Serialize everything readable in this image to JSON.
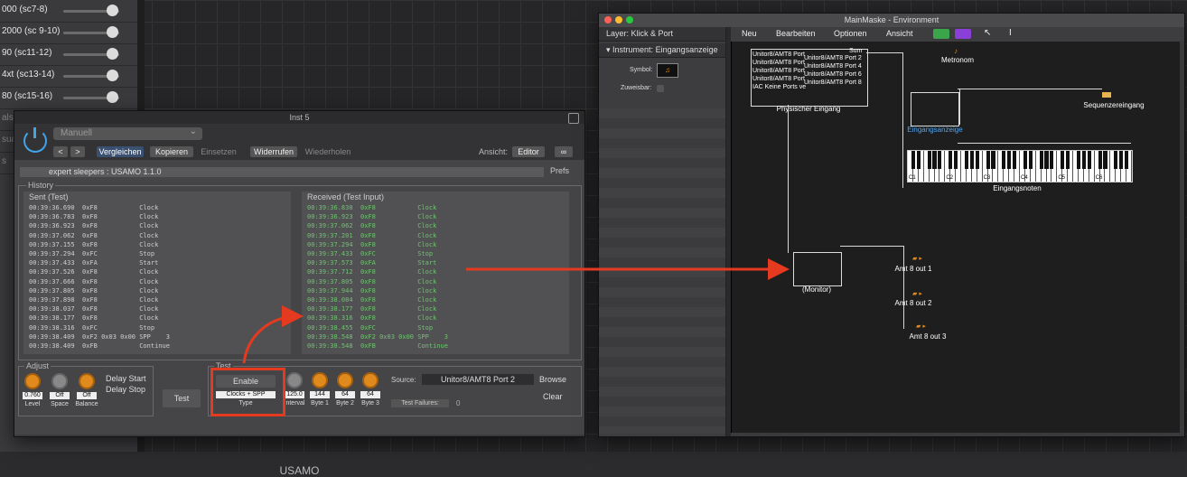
{
  "tracks": [
    "000 (sc7-8)",
    "2000 (sc 9-10)",
    "90 (sc11-12)",
    "4xt (sc13-14)",
    "80 (sc15-16)",
    "als",
    "sua",
    "s"
  ],
  "inst": {
    "title": "Inst 5",
    "preset": "Manuell",
    "buttons": {
      "back": "<",
      "forward": ">",
      "compare": "Vergleichen",
      "copy": "Kopieren",
      "paste": "Einsetzen",
      "undo": "Widerrufen",
      "redo": "Wiederholen"
    },
    "view_label": "Ansicht:",
    "view_value": "Editor",
    "plugin_name": "expert sleepers : USAMO 1.1.0",
    "prefs": "Prefs",
    "history_label": "History",
    "sent_header": "Sent (Test)",
    "recv_header": "Received (Test Input)",
    "sent": [
      "00:39:36.690  0xF8           Clock",
      "00:39:36.783  0xF8           Clock",
      "00:39:36.923  0xF8           Clock",
      "00:39:37.062  0xF8           Clock",
      "00:39:37.155  0xF8           Clock",
      "00:39:37.294  0xFC           Stop",
      "00:39:37.433  0xFA           Start",
      "00:39:37.526  0xF8           Clock",
      "00:39:37.666  0xF8           Clock",
      "00:39:37.805  0xF8           Clock",
      "00:39:37.898  0xF8           Clock",
      "00:39:38.037  0xF8           Clock",
      "00:39:38.177  0xF8           Clock",
      "00:39:38.316  0xFC           Stop",
      "00:39:38.409  0xF2 0x03 0x00 SPP    3",
      "00:39:38.409  0xFB           Continue"
    ],
    "received": [
      "00:39:36.830  0xF8           Clock",
      "00:39:36.923  0xF8           Clock",
      "00:39:37.062  0xF8           Clock",
      "00:39:37.201  0xF8           Clock",
      "00:39:37.294  0xF8           Clock",
      "00:39:37.433  0xFC           Stop",
      "00:39:37.573  0xFA           Start",
      "00:39:37.712  0xF8           Clock",
      "00:39:37.805  0xF8           Clock",
      "00:39:37.944  0xF8           Clock",
      "00:39:38.084  0xF8           Clock",
      "00:39:38.177  0xF8           Clock",
      "00:39:38.316  0xF8           Clock",
      "00:39:38.455  0xFC           Stop",
      "00:39:38.548  0xF2 0x03 0x00 SPP    3",
      "00:39:38.548  0xFB           Continue"
    ],
    "adjust_label": "Adjust",
    "level_val": "0.760",
    "level_lab": "Level",
    "space_val": "Off",
    "space_lab": "Space",
    "balance_val": "Off",
    "balance_lab": "Balance",
    "delay_start": "Delay Start",
    "delay_stop": "Delay Stop",
    "test_btn": "Test",
    "test_label": "Test",
    "enable": "Enable",
    "type_val": "Clocks + SPP",
    "type_lab": "Type",
    "interval_val": "125.0",
    "interval_lab": "Interval",
    "byte1_val": "144",
    "byte1_lab": "Byte 1",
    "byte2_val": "64",
    "byte2_lab": "Byte 2",
    "byte3_val": "64",
    "byte3_lab": "Byte 3",
    "source_label": "Source:",
    "source_val": "Unitor8/AMT8 Port 2",
    "browse": "Browse",
    "clear": "Clear",
    "failures_label": "Test Failures:",
    "failures_val": "0",
    "footer": "USAMO"
  },
  "env": {
    "title": "MainMaske - Environment",
    "layer_label": "Layer:",
    "layer_val": "Klick & Port",
    "instrument_label": "Instrument:",
    "instrument_val": "Eingangsanzeige",
    "symbol_label": "Symbol:",
    "assign_label": "Zuweisbar:",
    "menus": [
      "Neu",
      "Bearbeiten",
      "Optionen",
      "Ansicht"
    ],
    "phys_ports": [
      "Unitor8/AMT8 Port",
      "Unitor8/AMT8 Port",
      "Unitor8/AMT8 Port",
      "Unitor8/AMT8 Port",
      "IAC  Keine Ports ve"
    ],
    "phys_out": [
      "Sum",
      "Unitor8/AMT8 Port 2",
      "Unitor8/AMT8 Port 4",
      "Unitor8/AMT8 Port 6",
      "Unitor8/AMT8 Port 8"
    ],
    "phys_label": "Physischer Eingang",
    "metronom": "Metronom",
    "sequencer": "Sequenzereingang",
    "eingangsanzeige": "Eingangsanzeige",
    "keys_label": "Eingangsnoten",
    "octaves": [
      "C1",
      "C2",
      "C3",
      "C4",
      "C5",
      "C6"
    ],
    "monitor": "(Monitor)",
    "outs": [
      "Amt 8 out 1",
      "Amt 8  out 2",
      "Amt 8 out 3"
    ]
  }
}
